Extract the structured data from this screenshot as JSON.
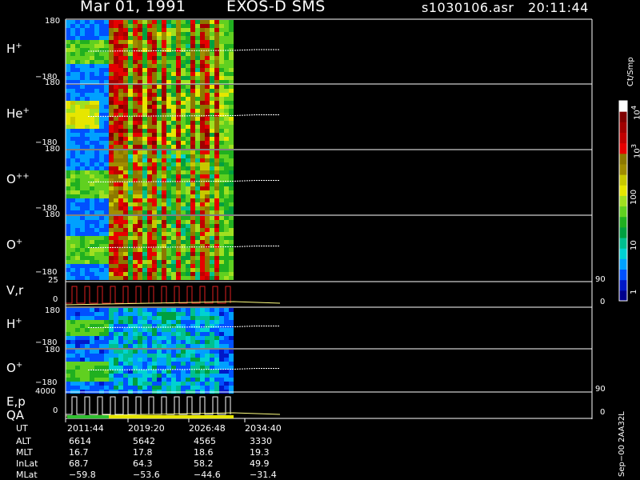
{
  "header": {
    "date": "Mar 01, 1991",
    "instrument": "EXOS-D SMS",
    "filename": "s1030106.asr",
    "time": "20:11:44"
  },
  "colors": {
    "background": "#000000",
    "foreground": "#ffffff",
    "colorbar": [
      "#00008c",
      "#0018c8",
      "#0050ff",
      "#00a0ff",
      "#00d2d2",
      "#00c090",
      "#00a040",
      "#20b020",
      "#60d020",
      "#a0e020",
      "#e6e600",
      "#c8c800",
      "#a08c00",
      "#8c7800",
      "#e60000",
      "#c00000",
      "#a00000",
      "#800000",
      "#ffffff"
    ]
  },
  "panels": [
    {
      "species": "H",
      "charge": "+",
      "ytop": "180",
      "ybot": "−180"
    },
    {
      "species": "He",
      "charge": "+",
      "ytop": "180",
      "ybot": "−180"
    },
    {
      "species": "O",
      "charge": "++",
      "ytop": "180",
      "ybot": "−180"
    },
    {
      "species": "O",
      "charge": "+",
      "ytop": "180",
      "ybot": "−180"
    },
    {
      "species": "V,r",
      "charge": "",
      "ytop": "25",
      "ybot": "0",
      "rtop": "90",
      "rbot": "0"
    },
    {
      "species": "H",
      "charge": "+",
      "ytop": "180",
      "ybot": "−180"
    },
    {
      "species": "O",
      "charge": "+",
      "ytop": "180",
      "ybot": "−180"
    },
    {
      "species": "E,p",
      "charge": "",
      "ytop": "4000",
      "ybot": "0",
      "rtop": "90",
      "rbot": "0"
    }
  ],
  "qa_label": "QA",
  "colorbar": {
    "unit": "Ct/Smp",
    "ticks": [
      {
        "base": "10",
        "exp": "4"
      },
      {
        "base": "10",
        "exp": "3"
      },
      {
        "base": "100",
        "exp": ""
      },
      {
        "base": "10",
        "exp": ""
      },
      {
        "base": "1",
        "exp": ""
      }
    ]
  },
  "footer": {
    "rows": [
      {
        "label": "UT",
        "values": [
          "2011:44",
          "2019:20",
          "2026:48",
          "2034:40"
        ]
      },
      {
        "label": "ALT",
        "values": [
          "6614",
          "5642",
          "4565",
          "3330"
        ]
      },
      {
        "label": "MLT",
        "values": [
          "16.7",
          "17.8",
          "18.6",
          "19.3"
        ]
      },
      {
        "label": "InLat",
        "values": [
          "68.7",
          "64.3",
          "58.2",
          "49.9"
        ]
      },
      {
        "label": "MLat",
        "values": [
          "−59.8",
          "−53.6",
          "−44.6",
          "−31.4"
        ]
      }
    ]
  },
  "side_label": "Sep−00 2AA32L",
  "chart_data": {
    "type": "heatmap",
    "x": [
      "2011:44",
      "2019:20",
      "2026:48",
      "2034:40"
    ],
    "panels": [
      "H+",
      "He+",
      "O++",
      "O+",
      "V,r",
      "H+",
      "O+",
      "E,p"
    ],
    "colorbar_range": [
      1,
      10000
    ],
    "colorbar_scale": "log",
    "colorbar_unit": "Ct/Smp",
    "ylim_angle": [
      -180,
      180
    ],
    "ylim_v": [
      0,
      25
    ],
    "ylim_e": [
      0,
      4000
    ]
  }
}
